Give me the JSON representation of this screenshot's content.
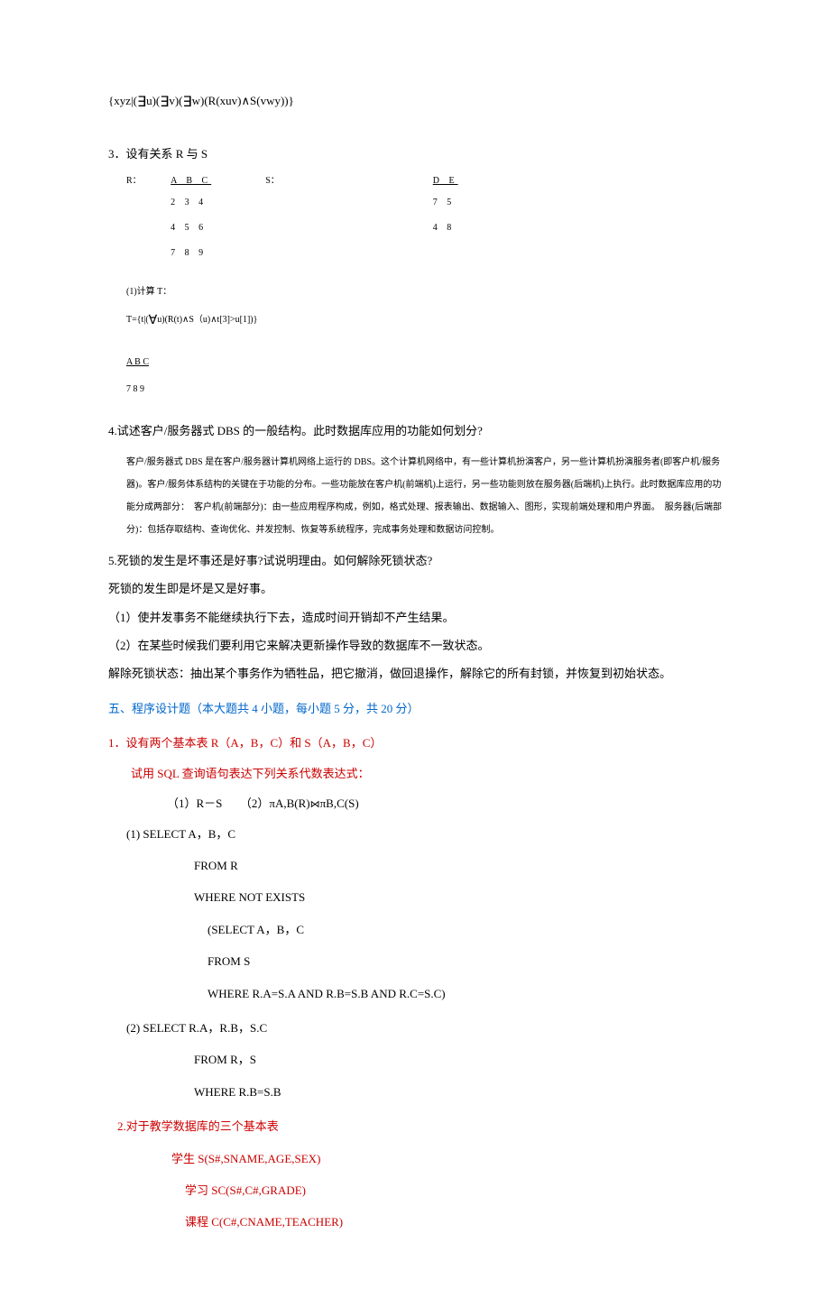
{
  "formula": "{xyz|(∃u)(∃v)(∃w)(R(xuv)∧S(vwy))}",
  "q3": {
    "title": "3．设有关系 R 与 S",
    "R_label": "R：",
    "S_label": "S：",
    "R_header": "A B C",
    "R_rows": [
      "2 3 4",
      "4 5 6",
      "7 8 9"
    ],
    "S_header": "D E",
    "S_rows": [
      "7 5",
      "4 8"
    ],
    "calc": "(1)计算 T：",
    "tformula": "T={t|(∀u)(R(t)∧S（u)∧t[3]>u[1])}",
    "answer_header": "A       B       C",
    "answer_row": "7     8     9"
  },
  "q4": {
    "title": "4.试述客户/服务器式 DBS 的一般结构。此时数据库应用的功能如何划分?",
    "answer": "客户/服务器式 DBS 是在客户/服务器计算机网络上运行的 DBS。这个计算机网络中，有一些计算机扮演客户，另一些计算机扮演服务者(即客户机/服务器)。客户/服务体系结构的关键在于功能的分布。一些功能放在客户机(前端机)上运行，另一些功能则放在服务器(后端机)上执行。此时数据库应用的功能分成两部分：　客户机(前端部分)：由一些应用程序构成，例如，格式处理、报表输出、数据输入、图形，实现前端处理和用户界面。　服务器(后端部分)：包括存取结构、查询优化、并发控制、恢复等系统程序，完成事务处理和数据访问控制。"
  },
  "q5": {
    "title": "5.死锁的发生是坏事还是好事?试说明理由。如何解除死锁状态?",
    "p1": "死锁的发生即是坏是又是好事。",
    "p2": "（1）使并发事务不能继续执行下去，造成时间开销却不产生结果。",
    "p3": "（2）在某些时候我们要利用它来解决更新操作导致的数据库不一致状态。",
    "p4": "解除死锁状态：抽出某个事务作为牺牲品，把它撤消，做回退操作，解除它的所有封锁，并恢复到初始状态。"
  },
  "section5": {
    "title": "五、程序设计题（本大题共 4 小题，每小题 5 分，共 20 分）"
  },
  "prog1": {
    "title": "1．设有两个基本表 R（A，B，C）和 S（A，B，C）",
    "subtitle": "试用 SQL 查询语句表达下列关系代数表达式：",
    "expr": "（1）R－S　　（2）πA,B(R)⋈πB,C(S)",
    "sql1_1": "(1)    SELECT A，B，C",
    "sql1_2": "FROM R",
    "sql1_3": "WHERE NOT EXISTS",
    "sql1_4": "(SELECT A，B，C",
    "sql1_5": "FROM S",
    "sql1_6": "WHERE R.A=S.A AND R.B=S.B AND R.C=S.C)",
    "sql2_1": "(2)   SELECT R.A，R.B，S.C",
    "sql2_2": "FROM R，S",
    "sql2_3": "WHERE R.B=S.B"
  },
  "prog2": {
    "title": "2.对于教学数据库的三个基本表",
    "t1": "学生 S(S#,SNAME,AGE,SEX)",
    "t2": "学习  SC(S#,C#,GRADE)",
    "t3": "课程  C(C#,CNAME,TEACHER)"
  }
}
